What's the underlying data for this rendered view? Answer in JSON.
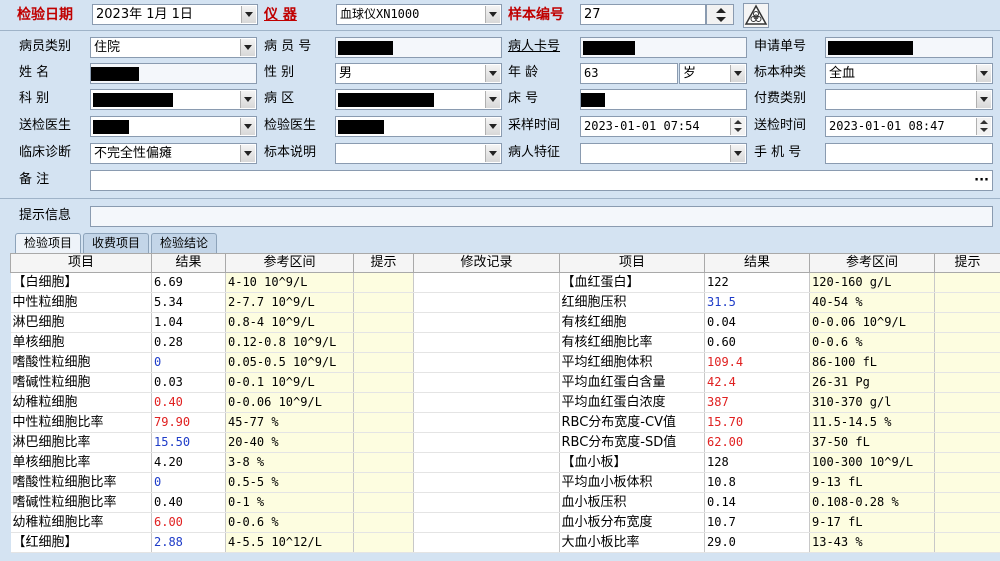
{
  "topbar": {
    "date_label": "检验日期",
    "date_value": "2023年 1月 1日",
    "instrument_label": "仪      器",
    "instrument_value": "血球仪XN1000",
    "sample_label": "样本编号",
    "sample_value": "27"
  },
  "form": {
    "patient_type_label": "病员类别",
    "patient_type_value": "住院",
    "patient_no_label": "病 员 号",
    "card_no_label": "病人卡号",
    "request_no_label": "申请单号",
    "name_label": "姓     名",
    "sex_label": "性     别",
    "sex_value": "男",
    "age_label": "年     龄",
    "age_value": "63",
    "age_unit": "岁",
    "specimen_type_label": "标本种类",
    "specimen_type_value": "全血",
    "dept_label": "科     别",
    "ward_label": "病     区",
    "bed_label": "床     号",
    "pay_type_label": "付费类别",
    "doctor_label": "送检医生",
    "lab_doctor_label": "检验医生",
    "collect_time_label": "采样时间",
    "collect_time_value": "2023-01-01  07:54",
    "send_time_label": "送检时间",
    "send_time_value": "2023-01-01  08:47",
    "diagnosis_label": "临床诊断",
    "diagnosis_value": "不完全性偏瘫",
    "specimen_note_label": "标本说明",
    "patient_feature_label": "病人特征",
    "phone_label": "手 机 号",
    "remark_label": "备     注",
    "hint_label": "提示信息"
  },
  "tabs": [
    "检验项目",
    "收费项目",
    "检验结论"
  ],
  "left_table": {
    "headers": [
      "项目",
      "结果",
      "参考区间",
      "提示",
      "修改记录"
    ],
    "rows": [
      {
        "item": "【白细胞】",
        "result": "6.69",
        "flag": "",
        "range": "4-10 10^9/L"
      },
      {
        "item": "中性粒细胞",
        "result": "5.34",
        "flag": "",
        "range": "2-7.7 10^9/L"
      },
      {
        "item": "淋巴细胞",
        "result": "1.04",
        "flag": "",
        "range": "0.8-4 10^9/L"
      },
      {
        "item": "单核细胞",
        "result": "0.28",
        "flag": "",
        "range": "0.12-0.8 10^9/L"
      },
      {
        "item": "嗜酸性粒细胞",
        "result": "0",
        "flag": "lo",
        "range": "0.05-0.5 10^9/L"
      },
      {
        "item": "嗜碱性粒细胞",
        "result": "0.03",
        "flag": "",
        "range": "0-0.1 10^9/L"
      },
      {
        "item": "幼稚粒细胞",
        "result": "0.40",
        "flag": "hi",
        "range": "0-0.06 10^9/L"
      },
      {
        "item": "中性粒细胞比率",
        "result": "79.90",
        "flag": "hi",
        "range": "45-77 %"
      },
      {
        "item": "淋巴细胞比率",
        "result": "15.50",
        "flag": "lo",
        "range": "20-40 %"
      },
      {
        "item": "单核细胞比率",
        "result": "4.20",
        "flag": "",
        "range": "3-8 %"
      },
      {
        "item": "嗜酸性粒细胞比率",
        "result": "0",
        "flag": "lo",
        "range": "0.5-5 %"
      },
      {
        "item": "嗜碱性粒细胞比率",
        "result": "0.40",
        "flag": "",
        "range": "0-1 %"
      },
      {
        "item": "幼稚粒细胞比率",
        "result": "6.00",
        "flag": "hi",
        "range": "0-0.6 %"
      },
      {
        "item": "【红细胞】",
        "result": "2.88",
        "flag": "lo",
        "range": "4-5.5 10^12/L"
      }
    ]
  },
  "right_table": {
    "headers": [
      "项目",
      "结果",
      "参考区间",
      "提示"
    ],
    "rows": [
      {
        "item": "【血红蛋白】",
        "result": "122",
        "flag": "",
        "range": "120-160 g/L"
      },
      {
        "item": "红细胞压积",
        "result": "31.5",
        "flag": "lo",
        "range": "40-54 %"
      },
      {
        "item": "有核红细胞",
        "result": "0.04",
        "flag": "",
        "range": "0-0.06 10^9/L"
      },
      {
        "item": "有核红细胞比率",
        "result": "0.60",
        "flag": "",
        "range": "0-0.6 %"
      },
      {
        "item": "平均红细胞体积",
        "result": "109.4",
        "flag": "hi",
        "range": "86-100 fL"
      },
      {
        "item": "平均血红蛋白含量",
        "result": "42.4",
        "flag": "hi",
        "range": "26-31 Pg"
      },
      {
        "item": "平均血红蛋白浓度",
        "result": "387",
        "flag": "hi",
        "range": "310-370 g/l"
      },
      {
        "item": "RBC分布宽度-CV值",
        "result": "15.70",
        "flag": "hi",
        "range": "11.5-14.5 %"
      },
      {
        "item": "RBC分布宽度-SD值",
        "result": "62.00",
        "flag": "hi",
        "range": "37-50 fL"
      },
      {
        "item": "【血小板】",
        "result": "128",
        "flag": "",
        "range": "100-300 10^9/L"
      },
      {
        "item": "平均血小板体积",
        "result": "10.8",
        "flag": "",
        "range": "9-13 fL"
      },
      {
        "item": "血小板压积",
        "result": "0.14",
        "flag": "",
        "range": "0.108-0.28 %"
      },
      {
        "item": "血小板分布宽度",
        "result": "10.7",
        "flag": "",
        "range": "9-17 fL"
      },
      {
        "item": "大血小板比率",
        "result": "29.0",
        "flag": "",
        "range": "13-43 %"
      }
    ]
  },
  "colors": {
    "high": "#e02020",
    "low": "#1e3cc8",
    "range_bg": "#fdfde0"
  },
  "icons": {
    "biohazard": "biohazard-icon"
  }
}
